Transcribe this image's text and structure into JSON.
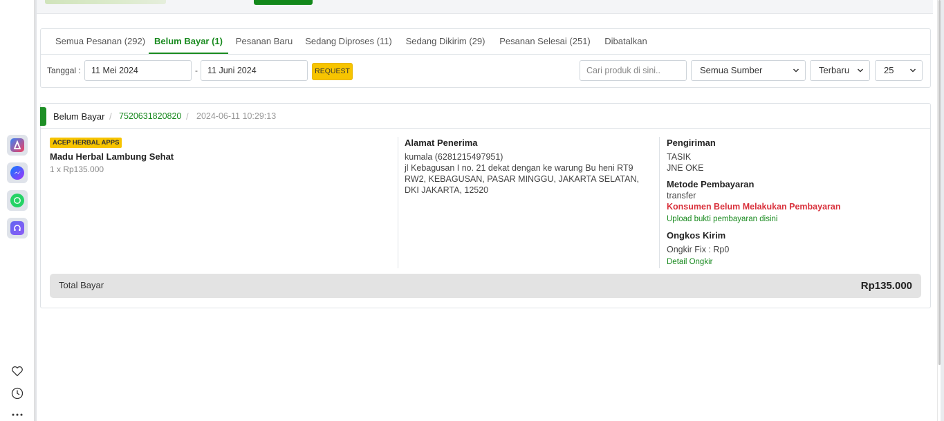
{
  "tabs": [
    {
      "label": "Semua Pesanan (292)"
    },
    {
      "label": "Belum Bayar (1)"
    },
    {
      "label": "Pesanan Baru"
    },
    {
      "label": "Sedang Diproses (11)"
    },
    {
      "label": "Sedang Dikirim (29)"
    },
    {
      "label": "Pesanan Selesai (251)"
    },
    {
      "label": "Dibatalkan"
    }
  ],
  "filters": {
    "date_label": "Tanggal :",
    "date_from": "11 Mei 2024",
    "date_separator": "-",
    "date_to": "11 Juni 2024",
    "request_label": "REQUEST",
    "search_placeholder": "Cari produk di sini..",
    "source_selected": "Semua Sumber",
    "sort_selected": "Terbaru",
    "per_page_selected": "25"
  },
  "order": {
    "status": "Belum Bayar",
    "separator": "/",
    "order_id": "7520631820820",
    "datetime": "2024-06-11 10:29:13",
    "source_badge": "ACEP HERBAL APPS",
    "product_name": "Madu Herbal Lambung Sehat",
    "product_qty": "1 x Rp135.000",
    "address_title": "Alamat Penerima",
    "recipient": "kumala (6281215497951)",
    "address": "jl Kebagusan I no. 21 dekat dengan ke warung Bu heni RT9 RW2, KEBAGUSAN, PASAR MINGGU, JAKARTA SELATAN, DKI JAKARTA, 12520",
    "shipping_title": "Pengiriman",
    "shipping_origin": "TASIK",
    "courier": "JNE OKE",
    "payment_title": "Metode Pembayaran",
    "payment_method": "transfer",
    "payment_warning": "Konsumen Belum Melakukan Pembayaran",
    "upload_link": "Upload bukti pembayaran disini",
    "ongkir_title": "Ongkos Kirim",
    "ongkir_fix": "Ongkir Fix : Rp0",
    "ongkir_detail": "Detail Ongkir",
    "total_label": "Total Bayar",
    "total_value": "Rp135.000"
  },
  "colors": {
    "accent_green": "#198a1f",
    "warning_red": "#d9313c",
    "badge_yellow": "#f7c400"
  }
}
